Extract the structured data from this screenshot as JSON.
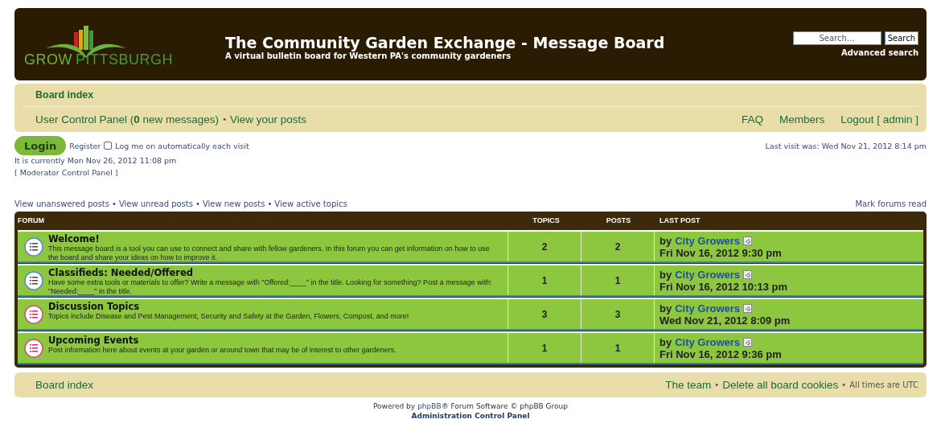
{
  "header": {
    "logo_words": [
      "GROW",
      "PITTSBURGH"
    ],
    "title": "The Community Garden Exchange - Message Board",
    "subtitle": "A virtual bulletin board for Western PA's community gardeners",
    "search": {
      "placeholder": "Search…",
      "button": "Search",
      "advanced": "Advanced search"
    }
  },
  "separator": "•",
  "navbar": {
    "breadcrumb": "Board index",
    "left_links": [
      "User Control Panel (**0** new messages)",
      "View your posts"
    ],
    "right_links": [
      "FAQ",
      "Members",
      "Logout [ admin ]"
    ]
  },
  "login": {
    "button": "Login",
    "register": "Register",
    "remember": {
      "label": "Log me on automatically each visit",
      "checked": false
    },
    "last_visit": "Last visit was: Wed Nov 21, 2012 8:14 pm"
  },
  "current_time": "It is currently Mon Nov 26, 2012 11:08 pm",
  "moderator_link": "[ Moderator Control Panel ]",
  "search_links": [
    "View unanswered posts",
    "View unread posts",
    "View new posts",
    "View active topics"
  ],
  "mark_read": "Mark forums read",
  "table": {
    "columns": [
      "FORUM",
      "TOPICS",
      "POSTS",
      "LAST POST"
    ],
    "rows": [
      {
        "title": "Welcome!",
        "description": "This message board is a tool you can use to connect and share with fellow gardeners. In this forum you can get information on how to use the board and share your ideas on how to improve it.",
        "unread": false,
        "topics": "2",
        "posts": "2",
        "by": "by",
        "author": "City Growers",
        "date": "Fri Nov 16, 2012 9:30 pm"
      },
      {
        "title": "Classifieds: Needed/Offered",
        "description": "Have some extra tools or materials to offer? Write a message with \"Offered:____\" in the title. Looking for something? Post a message with: \"Needed:____\" in the title.",
        "unread": false,
        "topics": "1",
        "posts": "1",
        "by": "by",
        "author": "City Growers",
        "date": "Fri Nov 16, 2012 10:13 pm"
      },
      {
        "title": "Discussion Topics",
        "description": "Topics include Disease and Pest Management, Security and Safety at the Garden, Flowers, Compost, and more!",
        "unread": true,
        "topics": "3",
        "posts": "3",
        "by": "by",
        "author": "City Growers",
        "date": "Wed Nov 21, 2012 8:09 pm"
      },
      {
        "title": "Upcoming Events",
        "description": "Post information here about events at your garden or around town that may be of interest to other gardeners.",
        "unread": true,
        "topics": "1",
        "posts": "1",
        "by": "by",
        "author": "City Growers",
        "date": "Fri Nov 16, 2012 9:36 pm"
      }
    ]
  },
  "footer_bar": {
    "left": "Board index",
    "right_links": [
      "The team",
      "Delete all board cookies"
    ],
    "timezone": "All times are UTC"
  },
  "credits": {
    "prefix": "Powered by",
    "link": "phpBB",
    "suffix": "® Forum Software © phpBB Group",
    "admin_link": "Administration Control Panel"
  }
}
